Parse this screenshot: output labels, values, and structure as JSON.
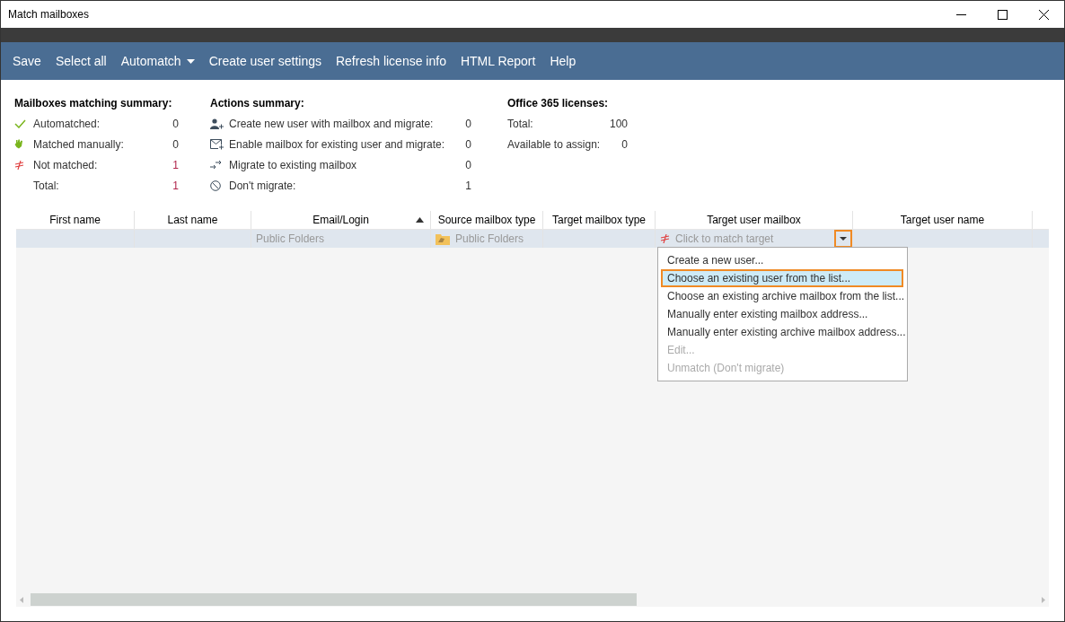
{
  "window": {
    "title": "Match mailboxes"
  },
  "toolbar": [
    {
      "label": "Save",
      "has_menu": false
    },
    {
      "label": "Select all",
      "has_menu": false
    },
    {
      "label": "Automatch",
      "has_menu": true
    },
    {
      "label": "Create user settings",
      "has_menu": false
    },
    {
      "label": "Refresh license info",
      "has_menu": false
    },
    {
      "label": "HTML Report",
      "has_menu": false
    },
    {
      "label": "Help",
      "has_menu": false
    }
  ],
  "summaries": [
    {
      "title": "Mailboxes matching summary:",
      "rows": [
        {
          "kind": "check",
          "label": "Automatched:",
          "value": "0",
          "alert": false
        },
        {
          "kind": "hand",
          "label": "Matched manually:",
          "value": "0",
          "alert": false
        },
        {
          "kind": "notequal",
          "label": "Not matched:",
          "value": "1",
          "alert": true
        },
        {
          "kind": "plain",
          "label": "Total:",
          "value": "1",
          "alert": true
        }
      ]
    },
    {
      "title": "Actions summary:",
      "rows": [
        {
          "kind": "useradd",
          "label": "Create new user with mailbox and migrate:",
          "value": "0",
          "alert": false
        },
        {
          "kind": "mailadd",
          "label": "Enable mailbox for existing user and migrate:",
          "value": "0",
          "alert": false
        },
        {
          "kind": "migrate",
          "label": "Migrate to existing mailbox",
          "value": "0",
          "alert": false
        },
        {
          "kind": "block",
          "label": "Don't migrate:",
          "value": "1",
          "alert": false
        }
      ]
    },
    {
      "title": "Office 365 licenses:",
      "rows": [
        {
          "kind": "plain",
          "label": "Total:",
          "value": "100",
          "alert": false
        },
        {
          "kind": "plain",
          "label": "Available to assign:",
          "value": "0",
          "alert": false
        }
      ]
    }
  ],
  "grid": {
    "columns": [
      {
        "label": "First name",
        "sorted": false
      },
      {
        "label": "Last name",
        "sorted": false
      },
      {
        "label": "Email/Login",
        "sorted": true
      },
      {
        "label": "Source mailbox type",
        "sorted": false
      },
      {
        "label": "Target mailbox type",
        "sorted": false
      },
      {
        "label": "Target user mailbox",
        "sorted": false
      },
      {
        "label": "Target user name",
        "sorted": false
      }
    ],
    "rows": [
      {
        "selected": true,
        "email": "Public Folders",
        "source_type": "Public Folders",
        "target_mailbox": "Click to match target",
        "dropdown_expanded": true
      }
    ]
  },
  "dropdown": [
    {
      "label": "Create a new user...",
      "selected": false,
      "disabled": false
    },
    {
      "label": "Choose an existing user from the list...",
      "selected": true,
      "disabled": false
    },
    {
      "label": "Choose an existing archive mailbox from the list...",
      "selected": false,
      "disabled": false
    },
    {
      "label": "Manually enter existing mailbox address...",
      "selected": false,
      "disabled": false
    },
    {
      "label": "Manually enter existing archive mailbox address...",
      "selected": false,
      "disabled": false
    },
    {
      "label": "Edit...",
      "selected": false,
      "disabled": true
    },
    {
      "label": "Unmatch (Don't migrate)",
      "selected": false,
      "disabled": true
    }
  ]
}
